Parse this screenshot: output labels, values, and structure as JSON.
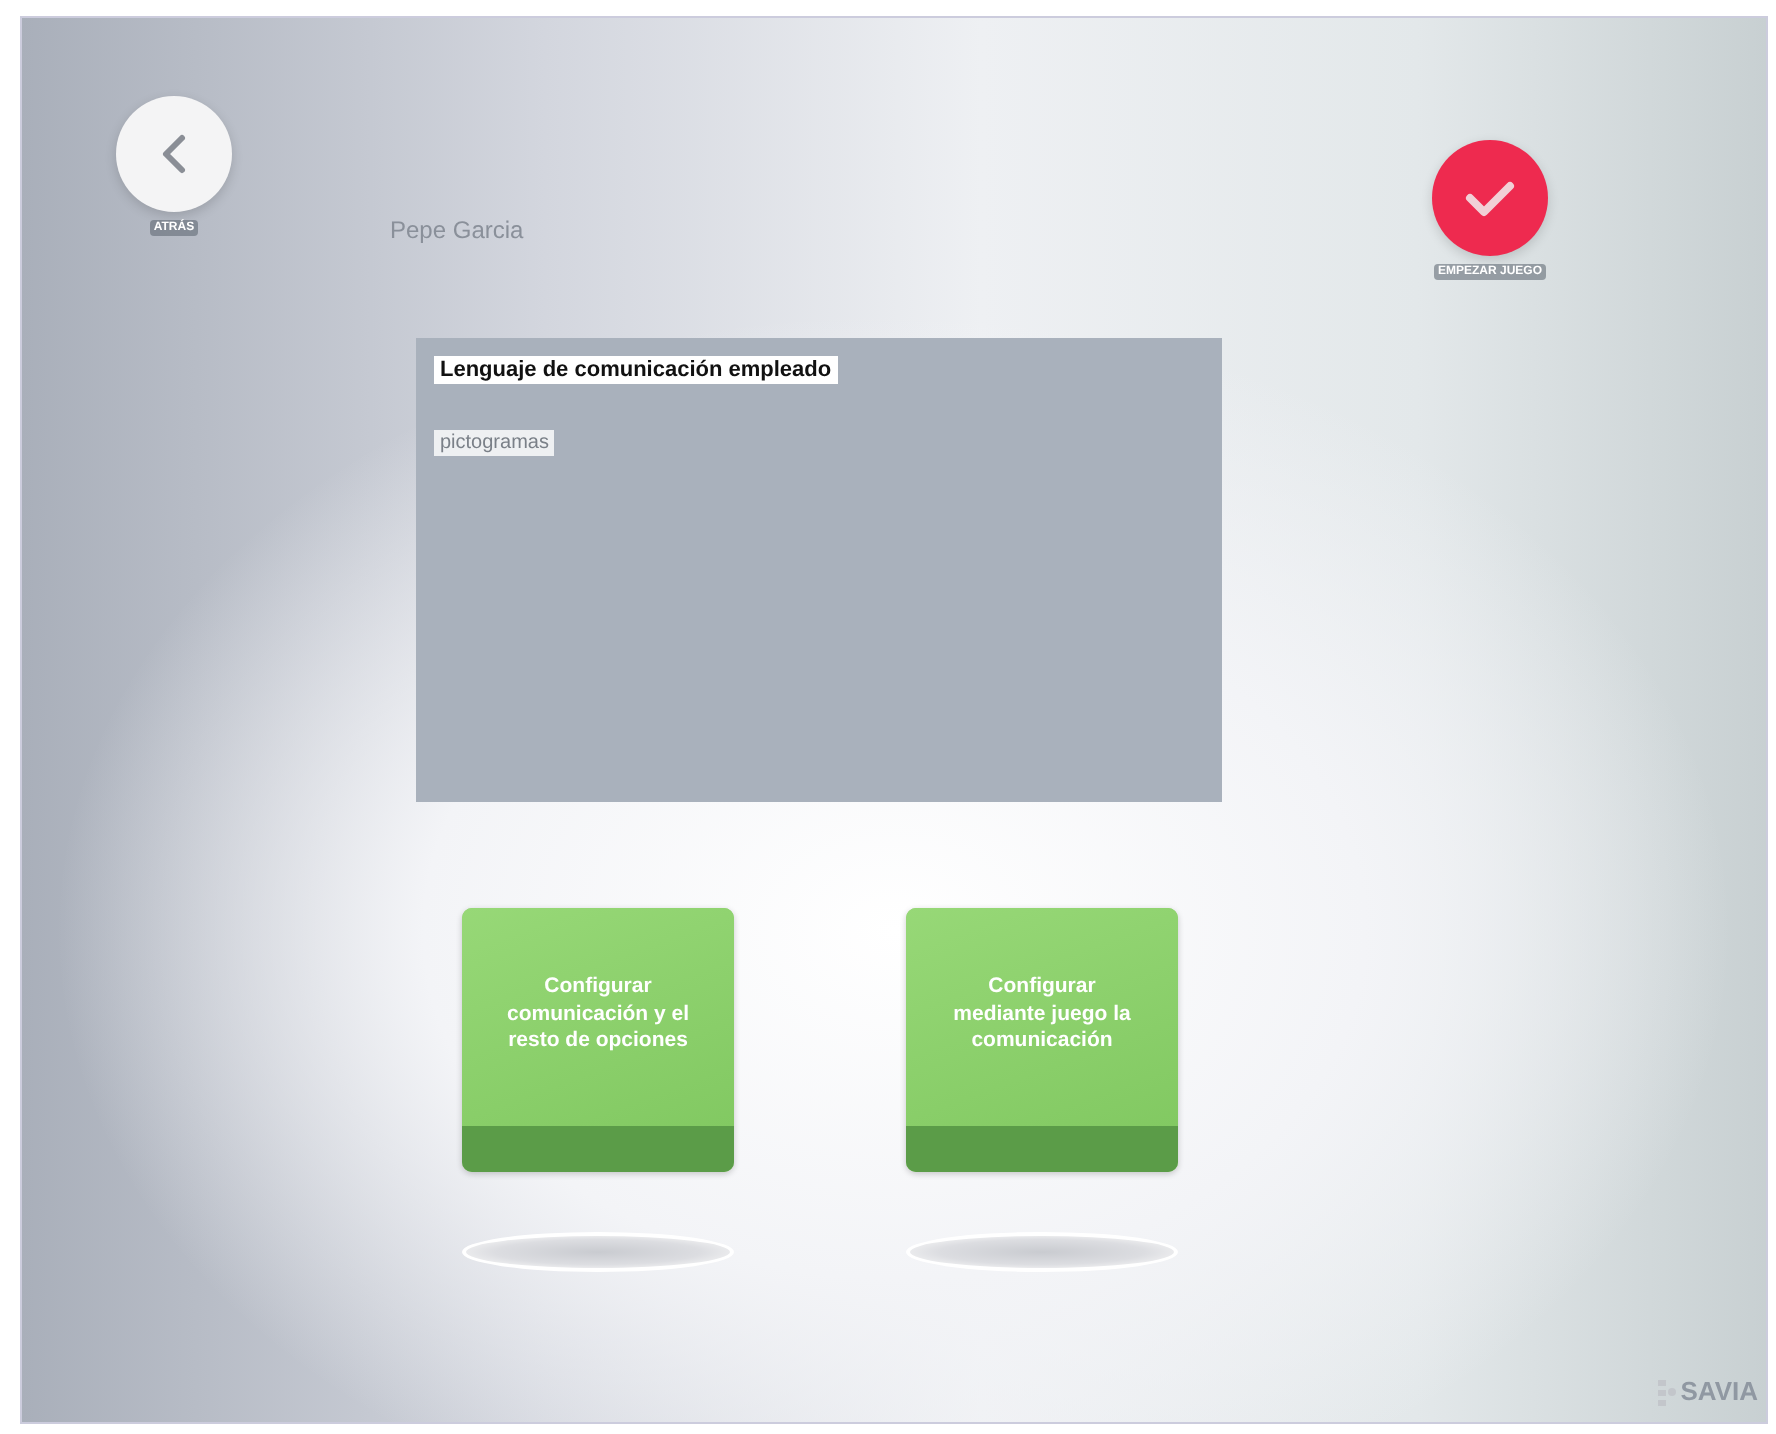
{
  "header": {
    "back": {
      "label": "ATRÁS"
    },
    "user_name": "Pepe Garcia",
    "start": {
      "label": "EMPEZAR JUEGO"
    }
  },
  "info_panel": {
    "title": "Lenguaje de comunicación empleado",
    "value": "pictogramas"
  },
  "options": [
    {
      "label": "Configurar comunicación y el resto de opciones"
    },
    {
      "label": "Configurar mediante juego la comunicación"
    }
  ],
  "logo": "SAVIA"
}
